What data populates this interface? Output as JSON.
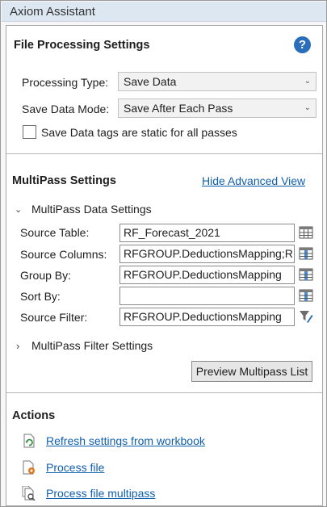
{
  "app": {
    "title": "Axiom Assistant"
  },
  "file_processing": {
    "heading": "File Processing Settings",
    "processing_type_label": "Processing Type:",
    "processing_type_value": "Save Data",
    "save_mode_label": "Save Data Mode:",
    "save_mode_value": "Save After Each Pass",
    "static_tags_label": "Save Data tags are static for all passes",
    "static_tags_checked": false
  },
  "multipass": {
    "heading": "MultiPass Settings",
    "hide_advanced_link": "Hide Advanced View",
    "data_settings_label": "MultiPass Data Settings",
    "fields": [
      {
        "label": "Source Table:",
        "value": "RF_Forecast_2021",
        "icon": "table-icon"
      },
      {
        "label": "Source Columns:",
        "value": "RFGROUP.DeductionsMapping;RF",
        "icon": "columns-icon"
      },
      {
        "label": "Group By:",
        "value": "RFGROUP.DeductionsMapping",
        "icon": "columns-icon"
      },
      {
        "label": "Sort By:",
        "value": "",
        "icon": "columns-icon"
      },
      {
        "label": "Source Filter:",
        "value": "RFGROUP.DeductionsMapping NOT",
        "icon": "filter-edit-icon"
      }
    ],
    "filter_settings_label": "MultiPass Filter Settings",
    "preview_button": "Preview Multipass List"
  },
  "actions": {
    "heading": "Actions",
    "items": [
      {
        "label": "Refresh settings from workbook",
        "icon": "refresh-icon"
      },
      {
        "label": "Process file",
        "icon": "process-file-icon"
      },
      {
        "label": "Process file multipass",
        "icon": "process-multipass-icon"
      }
    ]
  },
  "colors": {
    "accent": "#0f5fae",
    "title_bar": "#dde7f2",
    "help_icon": "#2a6ebb"
  }
}
